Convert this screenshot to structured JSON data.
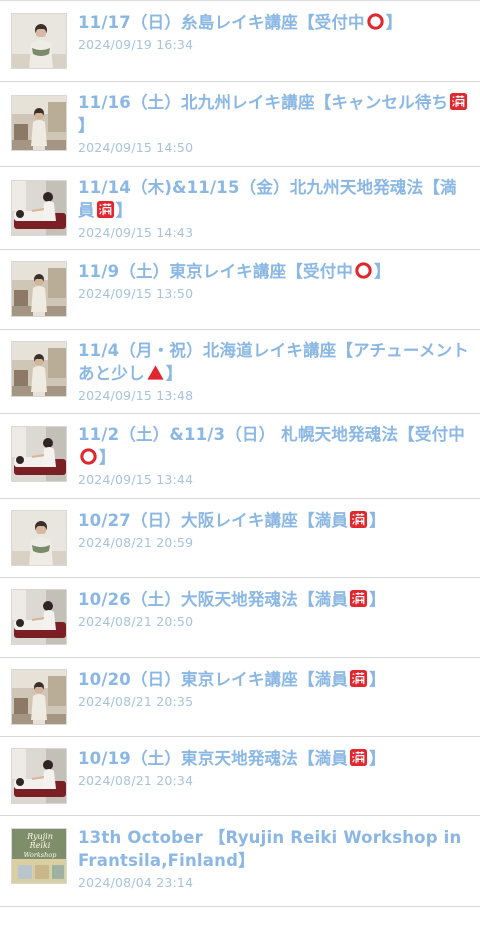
{
  "posts": [
    {
      "title_parts": [
        "11/17（日）糸島レイキ講座【受付中",
        "】"
      ],
      "badge": "circle",
      "date": "2024/09/19 16:34",
      "thumb": "portrait-white-wall"
    },
    {
      "title_parts": [
        "11/16（土）北九州レイキ講座【キャンセル待ち",
        "】"
      ],
      "badge": "full",
      "date": "2024/09/15 14:50",
      "thumb": "portrait-room"
    },
    {
      "title_parts": [
        "11/14（木)&11/15（金）北九州天地発魂法【満員",
        "】"
      ],
      "badge": "full",
      "date": "2024/09/15 14:43",
      "thumb": "session-bed"
    },
    {
      "title_parts": [
        "11/9（土）東京レイキ講座【受付中",
        "】"
      ],
      "badge": "circle",
      "date": "2024/09/15 13:50",
      "thumb": "portrait-room"
    },
    {
      "title_parts": [
        "11/4（月・祝）北海道レイキ講座【アチューメントあと少し",
        "】"
      ],
      "badge": "triangle",
      "date": "2024/09/15 13:48",
      "thumb": "portrait-room"
    },
    {
      "title_parts": [
        "11/2（土）&11/3（日） 札幌天地発魂法【受付中",
        "】"
      ],
      "badge": "circle",
      "date": "2024/09/15 13:44",
      "thumb": "session-bed"
    },
    {
      "title_parts": [
        "10/27（日）大阪レイキ講座【満員",
        "】"
      ],
      "badge": "full",
      "date": "2024/08/21 20:59",
      "thumb": "portrait-white-wall"
    },
    {
      "title_parts": [
        "10/26（土）大阪天地発魂法【満員",
        "】"
      ],
      "badge": "full",
      "date": "2024/08/21 20:50",
      "thumb": "session-bed"
    },
    {
      "title_parts": [
        "10/20（日）東京レイキ講座【満員",
        "】"
      ],
      "badge": "full",
      "date": "2024/08/21 20:35",
      "thumb": "portrait-room"
    },
    {
      "title_parts": [
        "10/19（土）東京天地発魂法【満員",
        "】"
      ],
      "badge": "full",
      "date": "2024/08/21 20:34",
      "thumb": "session-bed"
    },
    {
      "title_parts": [
        "13th October 【Ryujin Reiki Workshop in Frantsila,Finland",
        "】"
      ],
      "badge": "",
      "date": "2024/08/04 23:14",
      "thumb": "poster-ryujin-reiki"
    }
  ],
  "thumb_poster_text": [
    "Ryujin",
    "Reiki",
    "Workshop"
  ],
  "colors": {
    "title": "#8ab7e4",
    "date": "#a6c3e0",
    "divider": "#d6d6d6",
    "badge_circle": "#e0262f",
    "badge_full": "#e0262f",
    "badge_triangle": "#e0262f"
  }
}
